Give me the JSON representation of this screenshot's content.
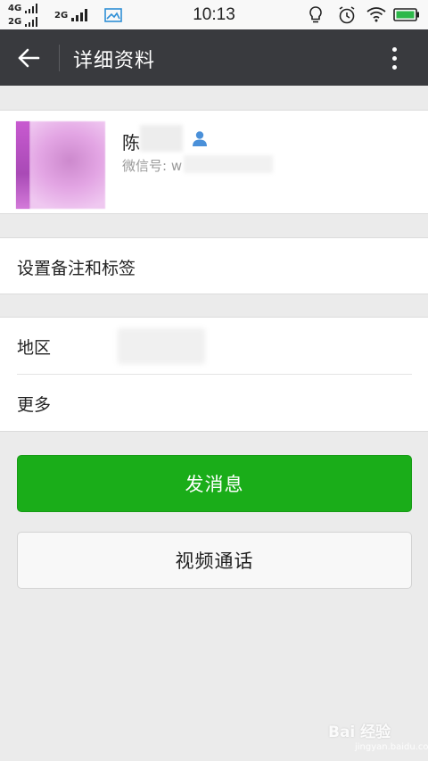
{
  "status_bar": {
    "sim1_label": "4G",
    "sim2_label": "2G",
    "sim3_label": "2G",
    "time": "10:13"
  },
  "app_bar": {
    "title": "详细资料"
  },
  "profile": {
    "name_visible": "陈",
    "wechat_id_label": "微信号: w"
  },
  "menu": {
    "remark_tags": "设置备注和标签",
    "region": "地区",
    "more": "更多"
  },
  "actions": {
    "send_message": "发消息",
    "video_call": "视频通话"
  },
  "colors": {
    "app_bar_bg": "#393a3e",
    "primary_green": "#1aad19",
    "contact_icon": "#4a90d9"
  },
  "icons": {
    "back": "arrow-left-icon",
    "more": "vertical-dots-icon",
    "contact": "person-icon"
  },
  "watermark": {
    "text": "Bai 经验",
    "sub": "jingyan.baidu.com"
  }
}
